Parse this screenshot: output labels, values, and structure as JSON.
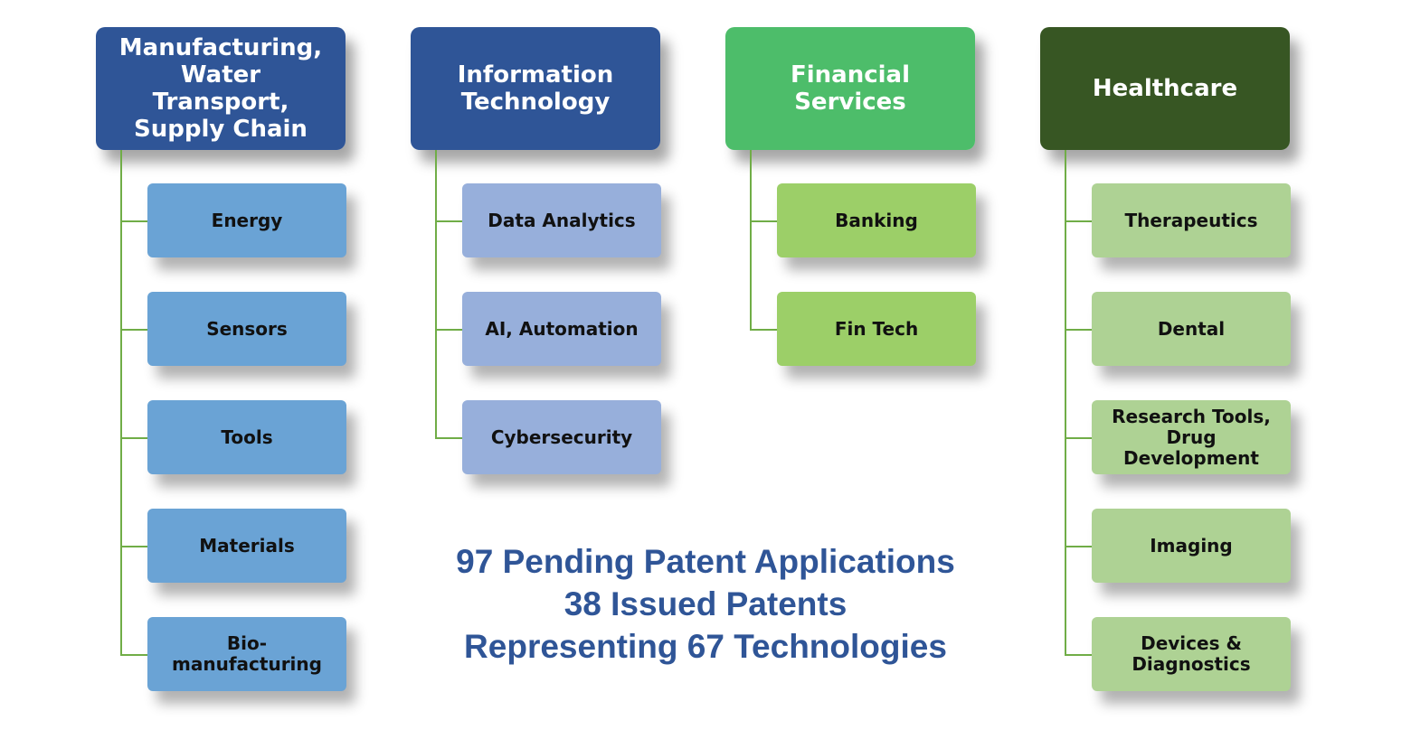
{
  "diagram": {
    "categories": [
      {
        "title": "Manufacturing,\nWater\nTransport,\nSupply Chain",
        "color": "#2f5597",
        "child_color": "#6aa3d5",
        "child_text_color": "#111111",
        "children": [
          "Energy",
          "Sensors",
          "Tools",
          "Materials",
          "Bio-\nmanufacturing"
        ]
      },
      {
        "title": "Information\nTechnology",
        "color": "#2f5597",
        "child_color": "#97afdb",
        "child_text_color": "#111111",
        "children": [
          "Data Analytics",
          "AI, Automation",
          "Cybersecurity"
        ]
      },
      {
        "title": "Financial\nServices",
        "color": "#4dbd6a",
        "child_color": "#9ccf68",
        "child_text_color": "#111111",
        "children": [
          "Banking",
          "Fin Tech"
        ]
      },
      {
        "title": "Healthcare",
        "color": "#375623",
        "child_color": "#aed294",
        "child_text_color": "#111111",
        "children": [
          "Therapeutics",
          "Dental",
          "Research Tools,\nDrug\nDevelopment",
          "Imaging",
          "Devices &\nDiagnostics"
        ]
      }
    ],
    "connector_color": "#70ad47"
  },
  "summary": {
    "line1": "97 Pending Patent Applications",
    "line2": "38 Issued Patents",
    "line3": "Representing 67 Technologies",
    "color": "#2f5597"
  }
}
